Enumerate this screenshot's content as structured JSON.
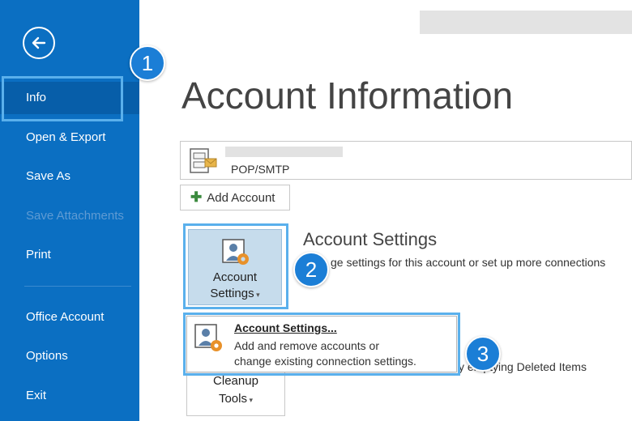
{
  "sidebar": {
    "items": [
      {
        "label": "Info",
        "state": "active"
      },
      {
        "label": "Open & Export",
        "state": "normal"
      },
      {
        "label": "Save As",
        "state": "normal"
      },
      {
        "label": "Save Attachments",
        "state": "disabled"
      },
      {
        "label": "Print",
        "state": "normal"
      },
      {
        "label": "Office Account",
        "state": "normal"
      },
      {
        "label": "Options",
        "state": "normal"
      },
      {
        "label": "Exit",
        "state": "normal"
      }
    ]
  },
  "main": {
    "title": "Account Information",
    "account": {
      "type": "POP/SMTP"
    },
    "add_account_label": "Add Account",
    "account_settings_button": {
      "line1": "Account",
      "line2": "Settings"
    },
    "section_heading": "Account Settings",
    "section_desc": "ge settings for this account or set up more connections",
    "cleanup_button": {
      "line1": "Cleanup",
      "line2": "Tools"
    },
    "cleanup_desc": "y emptying Deleted Items"
  },
  "dropdown": {
    "title": "Account Settings...",
    "desc_line1": "Add and remove accounts or",
    "desc_line2": "change existing connection settings."
  },
  "steps": [
    "1",
    "2",
    "3"
  ],
  "colors": {
    "sidebar_bg": "#0b6fc2",
    "highlight": "#5ab0ec",
    "step_badge": "#1b7ed6"
  }
}
